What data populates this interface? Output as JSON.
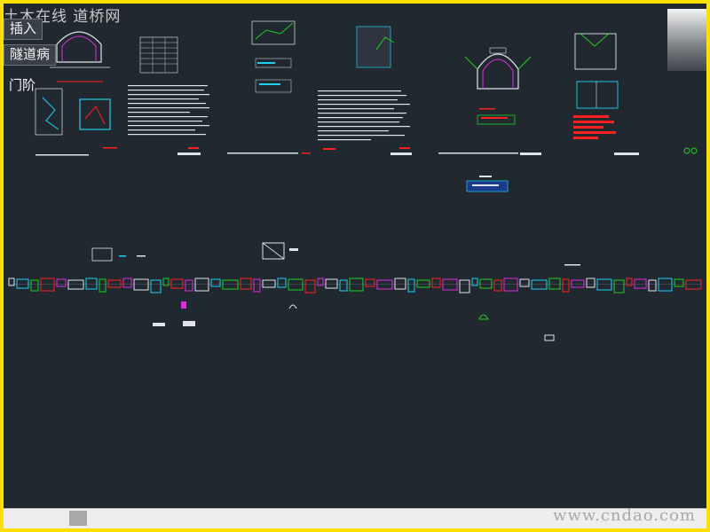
{
  "app": {
    "watermark_top": "土木在线 道桥网",
    "watermark_bottom": "www.cndao.com"
  },
  "tabs": {
    "insert": "插入",
    "tunnel": "隧道病",
    "side": "门阶"
  },
  "colors": {
    "canvas_bg": "#212830",
    "border": "#ffe000",
    "line_white": "#dfe4ea",
    "cyan": "#1fd0f0",
    "red": "#ff2020",
    "green": "#21d021",
    "magenta": "#e02ce0"
  }
}
